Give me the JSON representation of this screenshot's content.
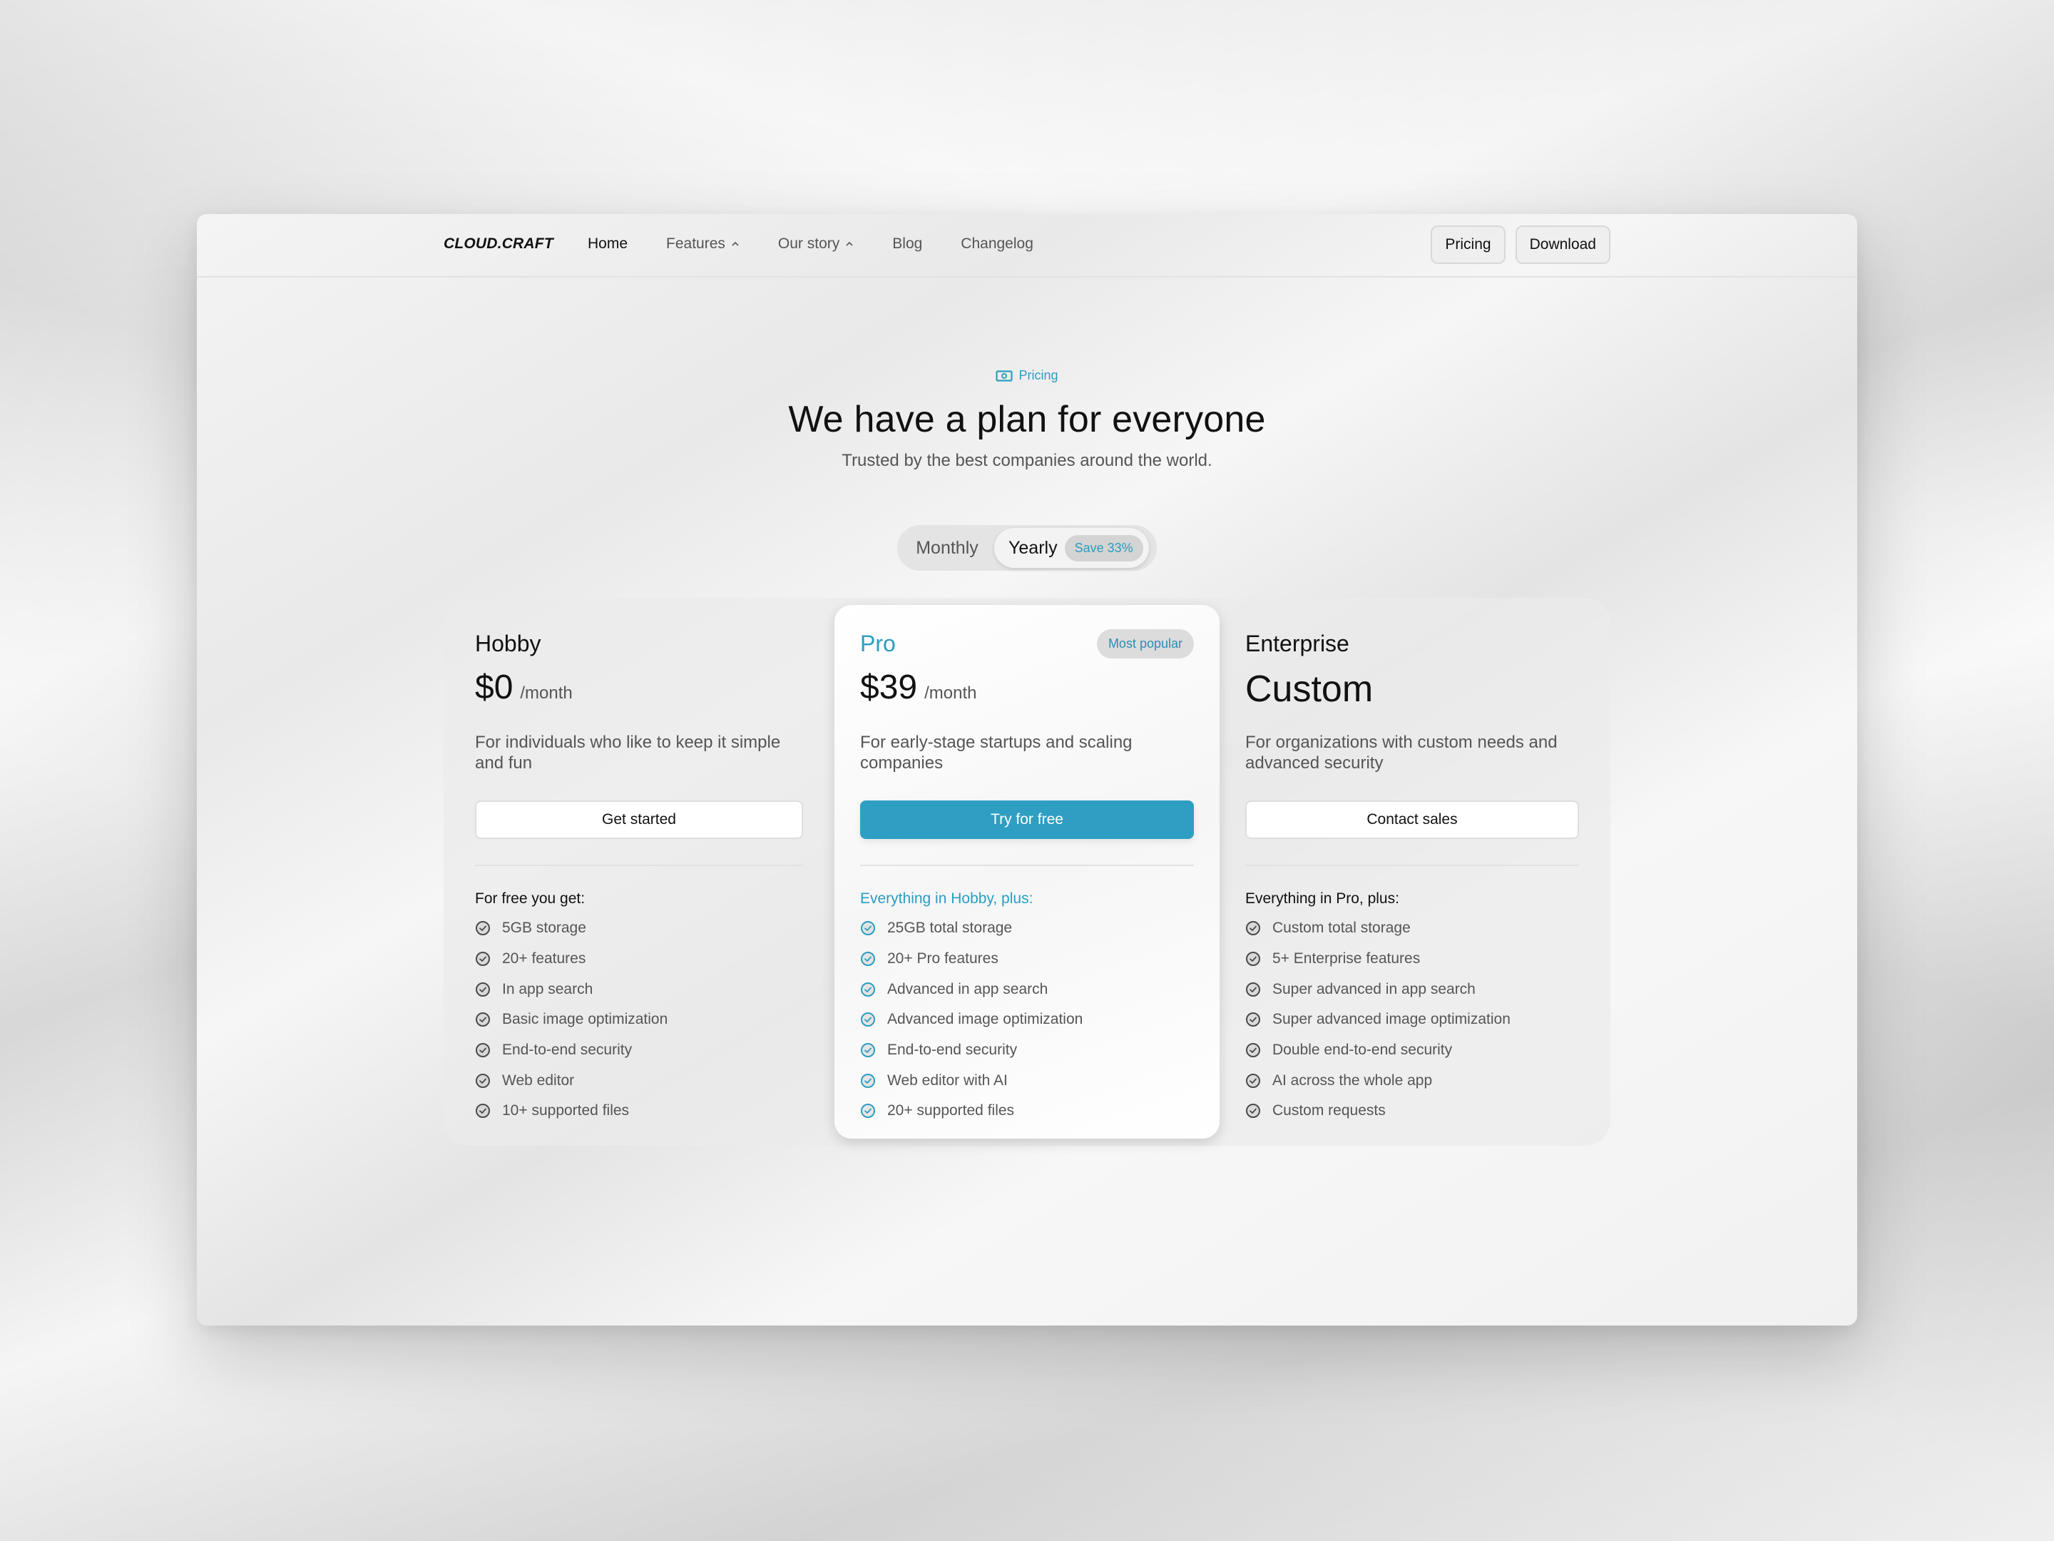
{
  "nav": {
    "brand": "CLOUD.CRAFT",
    "links": [
      {
        "label": "Home",
        "active": true,
        "dropdown": false
      },
      {
        "label": "Features",
        "active": false,
        "dropdown": true
      },
      {
        "label": "Our story",
        "active": false,
        "dropdown": true
      },
      {
        "label": "Blog",
        "active": false,
        "dropdown": false
      },
      {
        "label": "Changelog",
        "active": false,
        "dropdown": false
      }
    ],
    "buttons": {
      "pricing": "Pricing",
      "download": "Download"
    }
  },
  "hero": {
    "eyebrow_icon": "banknote-icon",
    "eyebrow": "Pricing",
    "title": "We have a plan for everyone",
    "subtitle": "Trusted by the best companies around the world."
  },
  "billing_toggle": {
    "monthly": "Monthly",
    "yearly": "Yearly",
    "selected": "Yearly",
    "save_badge": "Save 33%"
  },
  "plans": [
    {
      "name": "Hobby",
      "price": "$0",
      "period": "/month",
      "description": "For individuals who like to keep it simple and fun",
      "cta": "Get started",
      "features_heading": "For free you get:",
      "features": [
        "5GB storage",
        "20+ features",
        "In app search",
        "Basic image optimization",
        "End-to-end security",
        "Web editor",
        "10+ supported files"
      ]
    },
    {
      "name": "Pro",
      "badge": "Most popular",
      "price": "$39",
      "period": "/month",
      "description": "For early-stage startups and scaling companies",
      "cta": "Try for free",
      "features_heading": "Everything in Hobby, plus:",
      "features": [
        "25GB total storage",
        "20+ Pro features",
        "Advanced in app search",
        "Advanced image optimization",
        "End-to-end security",
        "Web editor with AI",
        "20+ supported files"
      ]
    },
    {
      "name": "Enterprise",
      "price": "Custom",
      "description": "For organizations with custom needs and advanced security",
      "cta": "Contact sales",
      "features_heading": "Everything in Pro, plus:",
      "features": [
        "Custom total storage",
        "5+ Enterprise features",
        "Super advanced in app search",
        "Super advanced image optimization",
        "Double end-to-end security",
        "AI across the whole app",
        "Custom requests"
      ]
    }
  ],
  "colors": {
    "accent": "#2e9fc2",
    "text": "#111111",
    "muted": "#555555"
  }
}
